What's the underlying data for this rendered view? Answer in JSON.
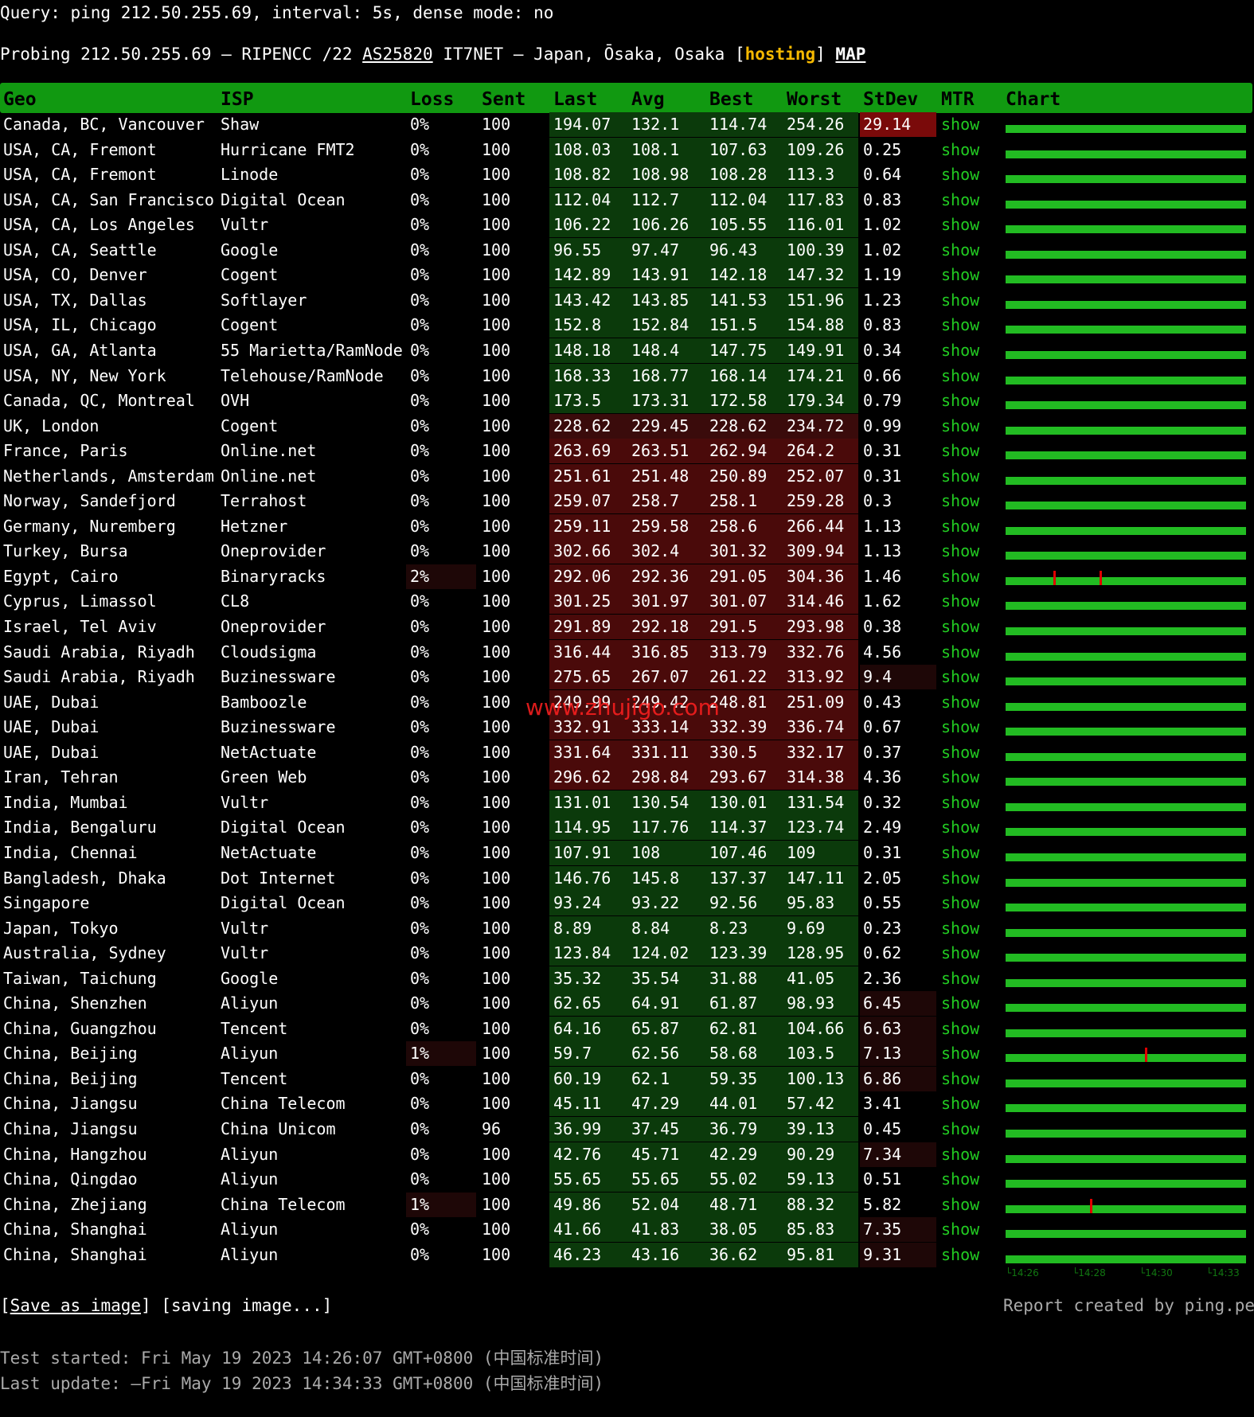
{
  "query_line": "Query: ping 212.50.255.69, interval: 5s, dense mode: no",
  "probe": {
    "prefix": "Probing 212.50.255.69 – RIPENCC /22 ",
    "asn": "AS25820",
    "middle": " IT7NET – Japan, Ōsaka, Osaka [",
    "hosting": "hosting",
    "close": "] ",
    "map": "MAP"
  },
  "columns": [
    "Geo",
    "ISP",
    "Loss",
    "Sent",
    "Last",
    "Avg",
    "Best",
    "Worst",
    "StDev",
    "MTR",
    "Chart"
  ],
  "mtr_label": "show",
  "rows": [
    {
      "geo": "Canada, BC, Vancouver",
      "isp": "Shaw",
      "loss": "0%",
      "sent": "100",
      "last": "194.07",
      "avg": "132.1",
      "best": "114.74",
      "worst": "254.26",
      "stdev": "29.14",
      "spikes": []
    },
    {
      "geo": "USA, CA, Fremont",
      "isp": "Hurricane FMT2",
      "loss": "0%",
      "sent": "100",
      "last": "108.03",
      "avg": "108.1",
      "best": "107.63",
      "worst": "109.26",
      "stdev": "0.25",
      "spikes": []
    },
    {
      "geo": "USA, CA, Fremont",
      "isp": "Linode",
      "loss": "0%",
      "sent": "100",
      "last": "108.82",
      "avg": "108.98",
      "best": "108.28",
      "worst": "113.3",
      "stdev": "0.64",
      "spikes": []
    },
    {
      "geo": "USA, CA, San Francisco",
      "isp": "Digital Ocean",
      "loss": "0%",
      "sent": "100",
      "last": "112.04",
      "avg": "112.7",
      "best": "112.04",
      "worst": "117.83",
      "stdev": "0.83",
      "spikes": []
    },
    {
      "geo": "USA, CA, Los Angeles",
      "isp": "Vultr",
      "loss": "0%",
      "sent": "100",
      "last": "106.22",
      "avg": "106.26",
      "best": "105.55",
      "worst": "116.01",
      "stdev": "1.02",
      "spikes": []
    },
    {
      "geo": "USA, CA, Seattle",
      "isp": "Google",
      "loss": "0%",
      "sent": "100",
      "last": "96.55",
      "avg": "97.47",
      "best": "96.43",
      "worst": "100.39",
      "stdev": "1.02",
      "spikes": []
    },
    {
      "geo": "USA, CO, Denver",
      "isp": "Cogent",
      "loss": "0%",
      "sent": "100",
      "last": "142.89",
      "avg": "143.91",
      "best": "142.18",
      "worst": "147.32",
      "stdev": "1.19",
      "spikes": []
    },
    {
      "geo": "USA, TX, Dallas",
      "isp": "Softlayer",
      "loss": "0%",
      "sent": "100",
      "last": "143.42",
      "avg": "143.85",
      "best": "141.53",
      "worst": "151.96",
      "stdev": "1.23",
      "spikes": []
    },
    {
      "geo": "USA, IL, Chicago",
      "isp": "Cogent",
      "loss": "0%",
      "sent": "100",
      "last": "152.8",
      "avg": "152.84",
      "best": "151.5",
      "worst": "154.88",
      "stdev": "0.83",
      "spikes": []
    },
    {
      "geo": "USA, GA, Atlanta",
      "isp": "55 Marietta/RamNode",
      "loss": "0%",
      "sent": "100",
      "last": "148.18",
      "avg": "148.4",
      "best": "147.75",
      "worst": "149.91",
      "stdev": "0.34",
      "spikes": []
    },
    {
      "geo": "USA, NY, New York",
      "isp": "Telehouse/RamNode",
      "loss": "0%",
      "sent": "100",
      "last": "168.33",
      "avg": "168.77",
      "best": "168.14",
      "worst": "174.21",
      "stdev": "0.66",
      "spikes": []
    },
    {
      "geo": "Canada, QC, Montreal",
      "isp": "OVH",
      "loss": "0%",
      "sent": "100",
      "last": "173.5",
      "avg": "173.31",
      "best": "172.58",
      "worst": "179.34",
      "stdev": "0.79",
      "spikes": []
    },
    {
      "geo": "UK, London",
      "isp": "Cogent",
      "loss": "0%",
      "sent": "100",
      "last": "228.62",
      "avg": "229.45",
      "best": "228.62",
      "worst": "234.72",
      "stdev": "0.99",
      "spikes": []
    },
    {
      "geo": "France, Paris",
      "isp": "Online.net",
      "loss": "0%",
      "sent": "100",
      "last": "263.69",
      "avg": "263.51",
      "best": "262.94",
      "worst": "264.2",
      "stdev": "0.31",
      "spikes": []
    },
    {
      "geo": "Netherlands, Amsterdam",
      "isp": "Online.net",
      "loss": "0%",
      "sent": "100",
      "last": "251.61",
      "avg": "251.48",
      "best": "250.89",
      "worst": "252.07",
      "stdev": "0.31",
      "spikes": []
    },
    {
      "geo": "Norway, Sandefjord",
      "isp": "Terrahost",
      "loss": "0%",
      "sent": "100",
      "last": "259.07",
      "avg": "258.7",
      "best": "258.1",
      "worst": "259.28",
      "stdev": "0.3",
      "spikes": []
    },
    {
      "geo": "Germany, Nuremberg",
      "isp": "Hetzner",
      "loss": "0%",
      "sent": "100",
      "last": "259.11",
      "avg": "259.58",
      "best": "258.6",
      "worst": "266.44",
      "stdev": "1.13",
      "spikes": []
    },
    {
      "geo": "Turkey, Bursa",
      "isp": "Oneprovider",
      "loss": "0%",
      "sent": "100",
      "last": "302.66",
      "avg": "302.4",
      "best": "301.32",
      "worst": "309.94",
      "stdev": "1.13",
      "spikes": []
    },
    {
      "geo": "Egypt, Cairo",
      "isp": "Binaryracks",
      "loss": "2%",
      "sent": "100",
      "last": "292.06",
      "avg": "292.36",
      "best": "291.05",
      "worst": "304.36",
      "stdev": "1.46",
      "spikes": [
        0.2,
        0.39
      ]
    },
    {
      "geo": "Cyprus, Limassol",
      "isp": "CL8",
      "loss": "0%",
      "sent": "100",
      "last": "301.25",
      "avg": "301.97",
      "best": "301.07",
      "worst": "314.46",
      "stdev": "1.62",
      "spikes": []
    },
    {
      "geo": "Israel, Tel Aviv",
      "isp": "Oneprovider",
      "loss": "0%",
      "sent": "100",
      "last": "291.89",
      "avg": "292.18",
      "best": "291.5",
      "worst": "293.98",
      "stdev": "0.38",
      "spikes": []
    },
    {
      "geo": "Saudi Arabia, Riyadh",
      "isp": "Cloudsigma",
      "loss": "0%",
      "sent": "100",
      "last": "316.44",
      "avg": "316.85",
      "best": "313.79",
      "worst": "332.76",
      "stdev": "4.56",
      "spikes": []
    },
    {
      "geo": "Saudi Arabia, Riyadh",
      "isp": "Buzinessware",
      "loss": "0%",
      "sent": "100",
      "last": "275.65",
      "avg": "267.07",
      "best": "261.22",
      "worst": "313.92",
      "stdev": "9.4",
      "spikes": []
    },
    {
      "geo": "UAE, Dubai",
      "isp": "Bamboozle",
      "loss": "0%",
      "sent": "100",
      "last": "249.99",
      "avg": "249.42",
      "best": "248.81",
      "worst": "251.09",
      "stdev": "0.43",
      "spikes": []
    },
    {
      "geo": "UAE, Dubai",
      "isp": "Buzinessware",
      "loss": "0%",
      "sent": "100",
      "last": "332.91",
      "avg": "333.14",
      "best": "332.39",
      "worst": "336.74",
      "stdev": "0.67",
      "spikes": []
    },
    {
      "geo": "UAE, Dubai",
      "isp": "NetActuate",
      "loss": "0%",
      "sent": "100",
      "last": "331.64",
      "avg": "331.11",
      "best": "330.5",
      "worst": "332.17",
      "stdev": "0.37",
      "spikes": []
    },
    {
      "geo": "Iran, Tehran",
      "isp": "Green Web",
      "loss": "0%",
      "sent": "100",
      "last": "296.62",
      "avg": "298.84",
      "best": "293.67",
      "worst": "314.38",
      "stdev": "4.36",
      "spikes": []
    },
    {
      "geo": "India, Mumbai",
      "isp": "Vultr",
      "loss": "0%",
      "sent": "100",
      "last": "131.01",
      "avg": "130.54",
      "best": "130.01",
      "worst": "131.54",
      "stdev": "0.32",
      "spikes": []
    },
    {
      "geo": "India, Bengaluru",
      "isp": "Digital Ocean",
      "loss": "0%",
      "sent": "100",
      "last": "114.95",
      "avg": "117.76",
      "best": "114.37",
      "worst": "123.74",
      "stdev": "2.49",
      "spikes": []
    },
    {
      "geo": "India, Chennai",
      "isp": "NetActuate",
      "loss": "0%",
      "sent": "100",
      "last": "107.91",
      "avg": "108",
      "best": "107.46",
      "worst": "109",
      "stdev": "0.31",
      "spikes": []
    },
    {
      "geo": "Bangladesh, Dhaka",
      "isp": "Dot Internet",
      "loss": "0%",
      "sent": "100",
      "last": "146.76",
      "avg": "145.8",
      "best": "137.37",
      "worst": "147.11",
      "stdev": "2.05",
      "spikes": []
    },
    {
      "geo": "Singapore",
      "isp": "Digital Ocean",
      "loss": "0%",
      "sent": "100",
      "last": "93.24",
      "avg": "93.22",
      "best": "92.56",
      "worst": "95.83",
      "stdev": "0.55",
      "spikes": []
    },
    {
      "geo": "Japan, Tokyo",
      "isp": "Vultr",
      "loss": "0%",
      "sent": "100",
      "last": "8.89",
      "avg": "8.84",
      "best": "8.23",
      "worst": "9.69",
      "stdev": "0.23",
      "spikes": []
    },
    {
      "geo": "Australia, Sydney",
      "isp": "Vultr",
      "loss": "0%",
      "sent": "100",
      "last": "123.84",
      "avg": "124.02",
      "best": "123.39",
      "worst": "128.95",
      "stdev": "0.62",
      "spikes": []
    },
    {
      "geo": "Taiwan, Taichung",
      "isp": "Google",
      "loss": "0%",
      "sent": "100",
      "last": "35.32",
      "avg": "35.54",
      "best": "31.88",
      "worst": "41.05",
      "stdev": "2.36",
      "spikes": []
    },
    {
      "geo": "China, Shenzhen",
      "isp": "Aliyun",
      "loss": "0%",
      "sent": "100",
      "last": "62.65",
      "avg": "64.91",
      "best": "61.87",
      "worst": "98.93",
      "stdev": "6.45",
      "spikes": []
    },
    {
      "geo": "China, Guangzhou",
      "isp": "Tencent",
      "loss": "0%",
      "sent": "100",
      "last": "64.16",
      "avg": "65.87",
      "best": "62.81",
      "worst": "104.66",
      "stdev": "6.63",
      "spikes": []
    },
    {
      "geo": "China, Beijing",
      "isp": "Aliyun",
      "loss": "1%",
      "sent": "100",
      "last": "59.7",
      "avg": "62.56",
      "best": "58.68",
      "worst": "103.5",
      "stdev": "7.13",
      "spikes": [
        0.58
      ]
    },
    {
      "geo": "China, Beijing",
      "isp": "Tencent",
      "loss": "0%",
      "sent": "100",
      "last": "60.19",
      "avg": "62.1",
      "best": "59.35",
      "worst": "100.13",
      "stdev": "6.86",
      "spikes": []
    },
    {
      "geo": "China, Jiangsu",
      "isp": "China Telecom",
      "loss": "0%",
      "sent": "100",
      "last": "45.11",
      "avg": "47.29",
      "best": "44.01",
      "worst": "57.42",
      "stdev": "3.41",
      "spikes": []
    },
    {
      "geo": "China, Jiangsu",
      "isp": "China Unicom",
      "loss": "0%",
      "sent": "96",
      "last": "36.99",
      "avg": "37.45",
      "best": "36.79",
      "worst": "39.13",
      "stdev": "0.45",
      "spikes": []
    },
    {
      "geo": "China, Hangzhou",
      "isp": "Aliyun",
      "loss": "0%",
      "sent": "100",
      "last": "42.76",
      "avg": "45.71",
      "best": "42.29",
      "worst": "90.29",
      "stdev": "7.34",
      "spikes": []
    },
    {
      "geo": "China, Qingdao",
      "isp": "Aliyun",
      "loss": "0%",
      "sent": "100",
      "last": "55.65",
      "avg": "55.65",
      "best": "55.02",
      "worst": "59.13",
      "stdev": "0.51",
      "spikes": []
    },
    {
      "geo": "China, Zhejiang",
      "isp": "China Telecom",
      "loss": "1%",
      "sent": "100",
      "last": "49.86",
      "avg": "52.04",
      "best": "48.71",
      "worst": "88.32",
      "stdev": "5.82",
      "spikes": [
        0.35
      ]
    },
    {
      "geo": "China, Shanghai",
      "isp": "Aliyun",
      "loss": "0%",
      "sent": "100",
      "last": "41.66",
      "avg": "41.83",
      "best": "38.05",
      "worst": "85.83",
      "stdev": "7.35",
      "spikes": []
    },
    {
      "geo": "China, Shanghai",
      "isp": "Aliyun",
      "loss": "0%",
      "sent": "100",
      "last": "46.23",
      "avg": "43.16",
      "best": "36.62",
      "worst": "95.81",
      "stdev": "9.31",
      "spikes": []
    }
  ],
  "chart_axis": [
    "└14:26",
    "└14:28",
    "└14:30",
    "└14:33"
  ],
  "footer": {
    "save_open": "[",
    "save_link": "Save as image",
    "save_rest": "] [saving image...]",
    "credit": "Report created by ping.pe",
    "test_started": "Test started: Fri May 19 2023 14:26:07 GMT+0800 (中国标准时间)",
    "last_update": "Last update: —Fri May 19 2023 14:34:33 GMT+0800 (中国标准时间)"
  },
  "watermark": "www.zhujigo.com",
  "colors": {
    "header_bg": "#119911",
    "mtr_link": "#22cc22",
    "hosting": "#f5b800",
    "spike": "#e00000",
    "chart_bar": "#22bb22"
  }
}
